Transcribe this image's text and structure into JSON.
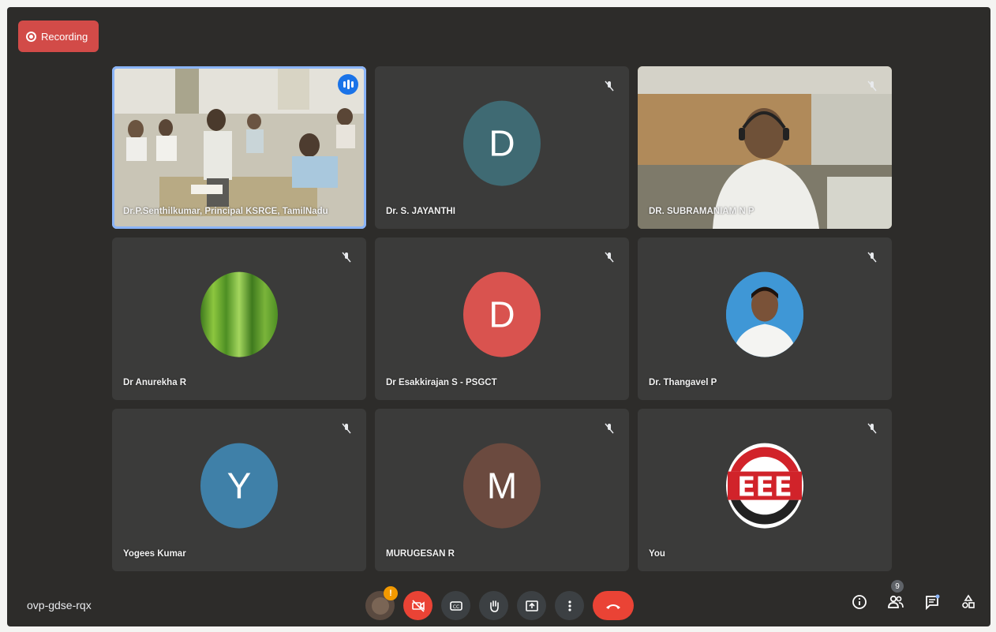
{
  "recording": {
    "label": "Recording",
    "color": "#d24b48"
  },
  "meeting": {
    "code": "ovp-gdse-rqx",
    "participant_count": "9"
  },
  "participants": [
    {
      "name": "Dr.P.Senthilkumar, Principal KSRCE, TamilNadu",
      "type": "video",
      "speaking": true
    },
    {
      "name": "Dr. S. JAYANTHI",
      "type": "initial",
      "initial": "D",
      "color": "#3f6a73",
      "muted": true
    },
    {
      "name": "DR. SUBRAMANIAM N P",
      "type": "video",
      "muted": true
    },
    {
      "name": "Dr Anurekha R",
      "type": "photo",
      "photo": "green-grass",
      "muted": true
    },
    {
      "name": "Dr Esakkirajan S - PSGCT",
      "type": "initial",
      "initial": "D",
      "color": "#d9534f",
      "muted": true
    },
    {
      "name": "Dr. Thangavel P",
      "type": "photo",
      "photo": "portrait",
      "muted": true
    },
    {
      "name": "Yogees Kumar",
      "type": "initial",
      "initial": "Y",
      "color": "#3f80a8",
      "muted": true
    },
    {
      "name": "MURUGESAN R",
      "type": "initial",
      "initial": "M",
      "color": "#6b4a3f",
      "muted": true
    },
    {
      "name": "You",
      "type": "photo",
      "photo": "eee-logo",
      "logo_text": "EEE",
      "muted": true
    }
  ],
  "controls": {
    "mic_alert": "!",
    "icons": [
      "avatar-icon",
      "camera-off-icon",
      "captions-icon",
      "raise-hand-icon",
      "present-icon",
      "more-options-icon",
      "end-call-icon"
    ]
  },
  "right_controls": [
    "info-icon",
    "people-icon",
    "chat-icon",
    "activities-icon"
  ],
  "colors": {
    "accent": "#8ab4f8",
    "danger": "#ea4335",
    "tile": "#3b3b3a",
    "background": "#2d2c2a"
  }
}
